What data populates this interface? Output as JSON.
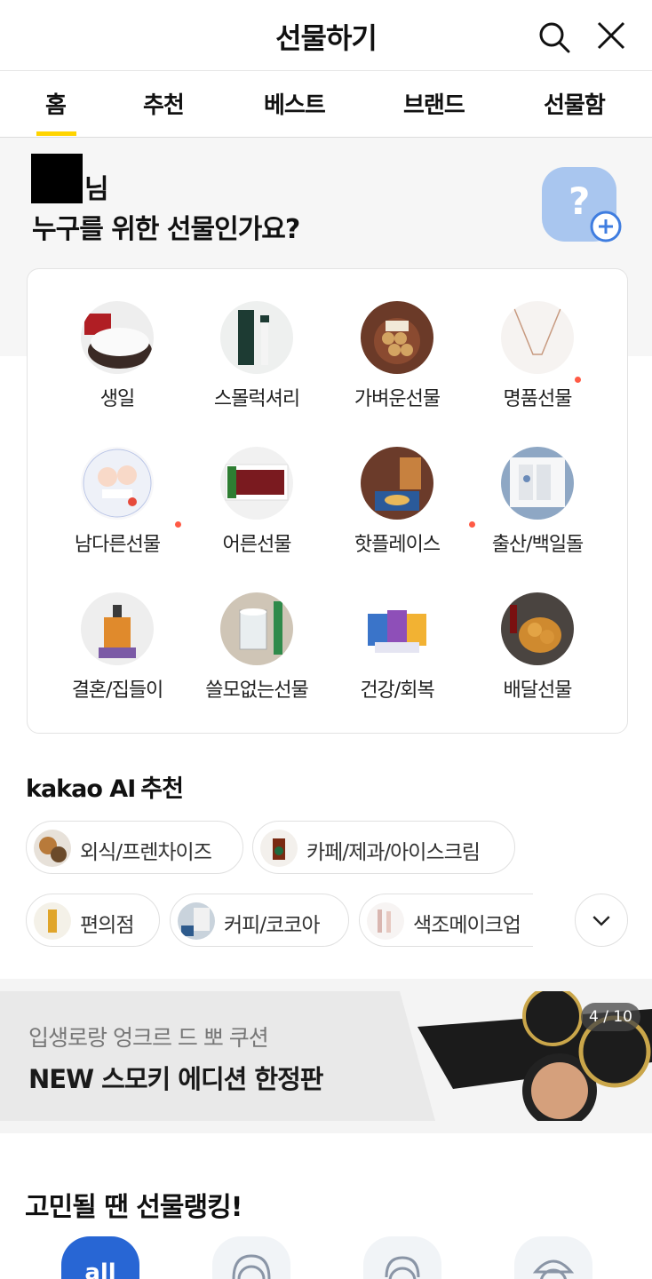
{
  "header": {
    "title": "선물하기",
    "search_icon": "search-icon",
    "close_icon": "close-icon"
  },
  "tabs": [
    {
      "label": "홈",
      "active": true
    },
    {
      "label": "추천"
    },
    {
      "label": "베스트"
    },
    {
      "label": "브랜드"
    },
    {
      "label": "선물함"
    }
  ],
  "greeting": {
    "name_suffix": "님",
    "question": "누구를 위한 선물인가요?",
    "friend_icon": "add-friend-icon"
  },
  "categories": [
    {
      "label": "생일",
      "icon": "cake-photo"
    },
    {
      "label": "스몰럭셔리",
      "icon": "hand-cream-photo"
    },
    {
      "label": "가벼운선물",
      "icon": "chocolate-photo"
    },
    {
      "label": "명품선물",
      "icon": "necklace-photo",
      "new_dot": true
    },
    {
      "label": "남다른선물",
      "icon": "character-cake-photo",
      "new_dot": true
    },
    {
      "label": "어른선물",
      "icon": "ginseng-set-photo"
    },
    {
      "label": "핫플레이스",
      "icon": "bakery-photo",
      "new_dot": true
    },
    {
      "label": "출산/백일돌",
      "icon": "baby-set-photo"
    },
    {
      "label": "결혼/집들이",
      "icon": "hand-wash-photo"
    },
    {
      "label": "쓸모없는선물",
      "icon": "glass-cup-photo"
    },
    {
      "label": "건강/회복",
      "icon": "supplement-photo"
    },
    {
      "label": "배달선물",
      "icon": "fried-chicken-photo"
    }
  ],
  "ai": {
    "brand": "kakao AI",
    "suffix": "추천"
  },
  "chips": [
    {
      "label": "외식/프렌차이즈",
      "icon": "food-photo"
    },
    {
      "label": "카페/제과/아이스크림",
      "icon": "coffee-photo"
    },
    {
      "label": "편의점",
      "icon": "convenience-photo"
    },
    {
      "label": "커피/코코아",
      "icon": "coffee-beans-photo"
    },
    {
      "label": "색조메이크업",
      "icon": "makeup-photo"
    }
  ],
  "expand_icon": "chevron-down-icon",
  "banner": {
    "subtitle": "입생로랑 엉크르 드 뽀 쿠션",
    "title": "NEW 스모키 에디션 한정판",
    "pager": "4 / 10"
  },
  "ranking": {
    "title": "고민될 땐 선물랭킹!",
    "tabs": [
      {
        "label": "all",
        "active": true
      },
      {
        "icon": "woman-icon"
      },
      {
        "icon": "man-icon"
      },
      {
        "icon": "kid-icon"
      }
    ]
  },
  "colors": {
    "accent": "#ffd400",
    "dot": "#ff5a45",
    "blue": "#2866d4",
    "friend_box": "#a9c6ef"
  }
}
